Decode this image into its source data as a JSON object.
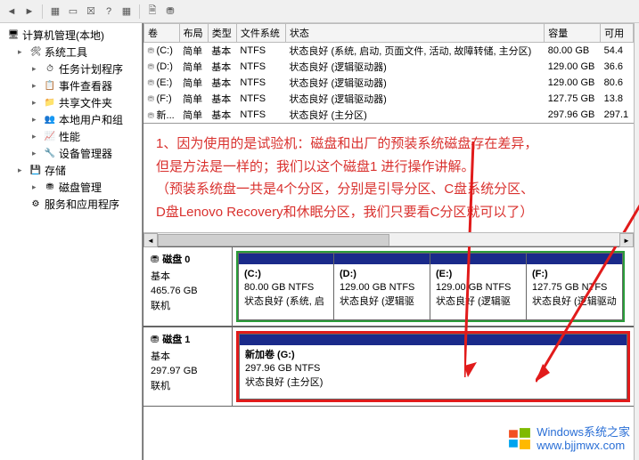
{
  "toolbar": {
    "icons": [
      "back",
      "fwd",
      "action",
      "window",
      "x",
      "help",
      "refresh",
      "save",
      "cfg"
    ]
  },
  "tree": {
    "root": "计算机管理(本地)",
    "sections": [
      {
        "label": "系统工具",
        "icon": "🛠",
        "children": [
          {
            "label": "任务计划程序",
            "icon": "⏱"
          },
          {
            "label": "事件查看器",
            "icon": "📋"
          },
          {
            "label": "共享文件夹",
            "icon": "📁"
          },
          {
            "label": "本地用户和组",
            "icon": "👥"
          },
          {
            "label": "性能",
            "icon": "📈"
          },
          {
            "label": "设备管理器",
            "icon": "🔧"
          }
        ]
      },
      {
        "label": "存储",
        "icon": "💾",
        "children": [
          {
            "label": "磁盘管理",
            "icon": "⛃"
          }
        ]
      },
      {
        "label": "服务和应用程序",
        "icon": "⚙",
        "children": []
      }
    ]
  },
  "table": {
    "headers": [
      "卷",
      "布局",
      "类型",
      "文件系统",
      "状态",
      "容量",
      "可用"
    ],
    "rows": [
      [
        "(C:)",
        "简单",
        "基本",
        "NTFS",
        "状态良好 (系统, 启动, 页面文件, 活动, 故障转储, 主分区)",
        "80.00 GB",
        "54.4"
      ],
      [
        "(D:)",
        "简单",
        "基本",
        "NTFS",
        "状态良好 (逻辑驱动器)",
        "129.00 GB",
        "36.6"
      ],
      [
        "(E:)",
        "简单",
        "基本",
        "NTFS",
        "状态良好 (逻辑驱动器)",
        "129.00 GB",
        "80.6"
      ],
      [
        "(F:)",
        "简单",
        "基本",
        "NTFS",
        "状态良好 (逻辑驱动器)",
        "127.75 GB",
        "13.8"
      ],
      [
        "新...",
        "简单",
        "基本",
        "NTFS",
        "状态良好 (主分区)",
        "297.96 GB",
        "297.1"
      ]
    ]
  },
  "note": {
    "line1": "1、因为使用的是试验机：磁盘和出厂的预装系统磁盘存在差异，",
    "line2": "但是方法是一样的；我们以这个磁盘1 进行操作讲解。",
    "line3": "（预装系统盘一共是4个分区，分别是引导分区、C盘系统分区、",
    "line4": "D盘Lenovo Recovery和休眠分区，我们只要看C分区就可以了）"
  },
  "disks": [
    {
      "name": "磁盘 0",
      "type": "基本",
      "size": "465.76 GB",
      "status": "联机",
      "parts": [
        {
          "letter": "(C:)",
          "size": "80.00 GB NTFS",
          "state": "状态良好 (系统, 启"
        },
        {
          "letter": "(D:)",
          "size": "129.00 GB NTFS",
          "state": "状态良好 (逻辑驱"
        },
        {
          "letter": "(E:)",
          "size": "129.00 GB NTFS",
          "state": "状态良好 (逻辑驱"
        },
        {
          "letter": "(F:)",
          "size": "127.75 GB NTFS",
          "state": "状态良好 (逻辑驱动"
        }
      ]
    },
    {
      "name": "磁盘 1",
      "type": "基本",
      "size": "297.97 GB",
      "status": "联机",
      "parts": [
        {
          "letter": "新加卷  (G:)",
          "size": "297.96 GB NTFS",
          "state": "状态良好 (主分区)"
        }
      ]
    }
  ],
  "watermark": {
    "title": "Windows系统之家",
    "url": "www.bjjmwx.com"
  }
}
